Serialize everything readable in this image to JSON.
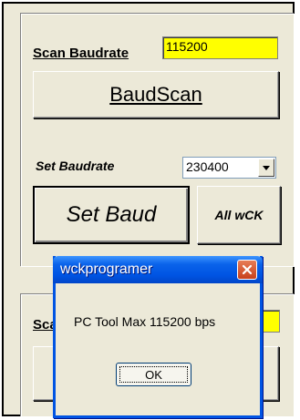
{
  "panel_top": {
    "scan_baudrate_label": "Scan Baudrate",
    "scan_baudrate_value": "115200",
    "baudscan_button": "BaudScan",
    "set_baudrate_label": "Set Baudrate",
    "set_baudrate_selected": "230400",
    "set_baud_button": "Set Baud",
    "all_wck_button": "All wCK"
  },
  "panel_bottom": {
    "scan_label_partial": "Sca"
  },
  "dialog": {
    "title": "wckprogramer",
    "message": "PC Tool Max 115200 bps",
    "ok_button": "OK"
  }
}
